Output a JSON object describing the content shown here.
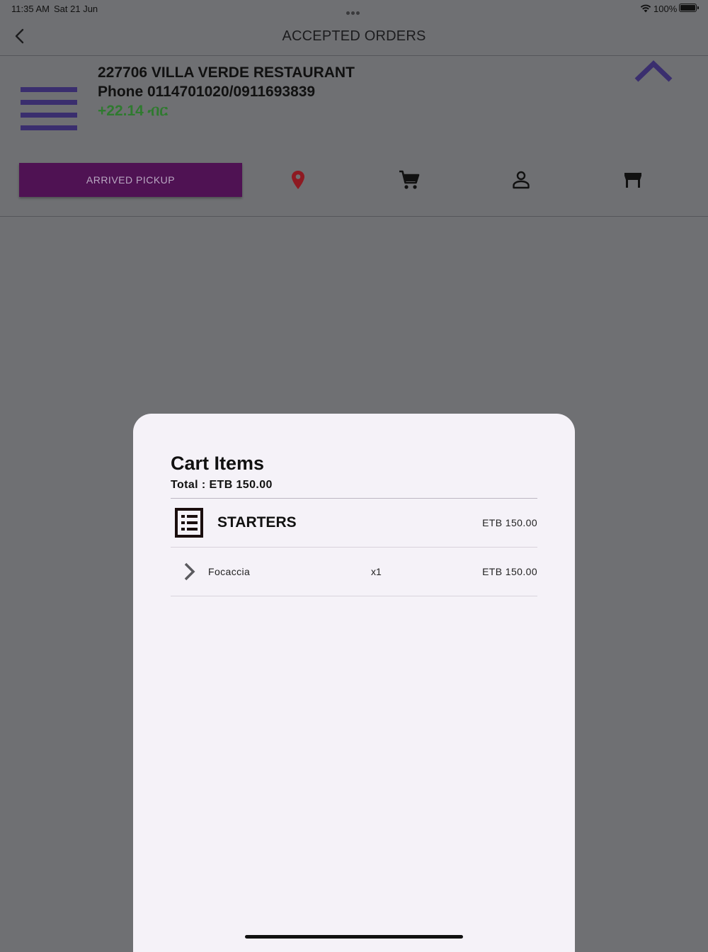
{
  "status_bar": {
    "time": "11:35 AM",
    "date": "Sat 21 Jun",
    "battery_percent": "100%",
    "icons": [
      "wifi-icon",
      "battery-icon"
    ]
  },
  "nav": {
    "title": "ACCEPTED ORDERS",
    "back_icon": "chevron-left-icon"
  },
  "order": {
    "restaurant": "227706 VILLA VERDE RESTAURANT",
    "phone": "Phone 0114701020/0911693839",
    "earning": "+22.14 ብር",
    "arrived_label": "ARRIVED PICKUP",
    "actions": [
      "location-pin-icon",
      "cart-icon",
      "customer-icon",
      "store-icon"
    ]
  },
  "cart": {
    "heading": "Cart Items",
    "total": "Total : ETB  150.00",
    "categories": [
      {
        "name": "STARTERS",
        "price": "ETB 150.00",
        "items": [
          {
            "name": "Focaccia",
            "qty": "x1",
            "price": "ETB 150.00"
          }
        ]
      }
    ]
  },
  "colors": {
    "overlay_bg": "#6f7073",
    "sheet_bg": "#f5f2f8",
    "accent_purple": "#4f1253",
    "icon_indigo": "#3a2e6e",
    "pin_red": "#8e1a22",
    "earning_green": "#2f7a2f"
  }
}
